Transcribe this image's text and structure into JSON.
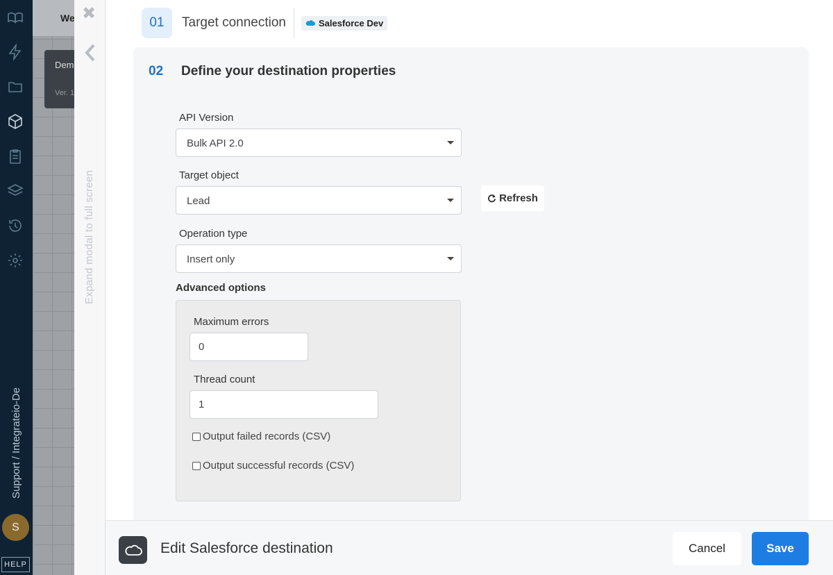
{
  "sidebar": {
    "icons": [
      "logo-icon",
      "bolt-icon",
      "folder-icon",
      "package-icon",
      "clipboard-icon",
      "layers-icon",
      "history-icon",
      "settings-icon"
    ],
    "workspace_label": "Support / Integrateio-De",
    "avatar_initial": "S",
    "help_label": "HELP"
  },
  "background": {
    "header_fragment": "We",
    "card_title_fragment": "Dem",
    "card_version_fragment": "Ver. 1"
  },
  "modal_strip": {
    "close_glyph": "✖",
    "expand_label": "Expand modal to full screen"
  },
  "step1": {
    "number": "01",
    "title": "Target connection",
    "connection_name": "Salesforce Dev"
  },
  "step2": {
    "number": "02",
    "title": "Define your destination properties",
    "api_version": {
      "label": "API Version",
      "value": "Bulk API 2.0"
    },
    "target_object": {
      "label": "Target object",
      "value": "Lead"
    },
    "refresh_label": "Refresh",
    "operation_type": {
      "label": "Operation type",
      "value": "Insert only"
    },
    "advanced": {
      "title": "Advanced options",
      "max_errors": {
        "label": "Maximum errors",
        "value": "0"
      },
      "thread_count": {
        "label": "Thread count",
        "value": "1"
      },
      "output_failed": {
        "label": "Output failed records (CSV)",
        "checked": false
      },
      "output_successful": {
        "label": "Output successful records (CSV)",
        "checked": false
      }
    }
  },
  "footer": {
    "title": "Edit Salesforce destination",
    "cancel_label": "Cancel",
    "save_label": "Save"
  },
  "colors": {
    "accent": "#1e7de3",
    "sidebar_bg": "#0f2233",
    "step_number": "#1f73c4"
  }
}
